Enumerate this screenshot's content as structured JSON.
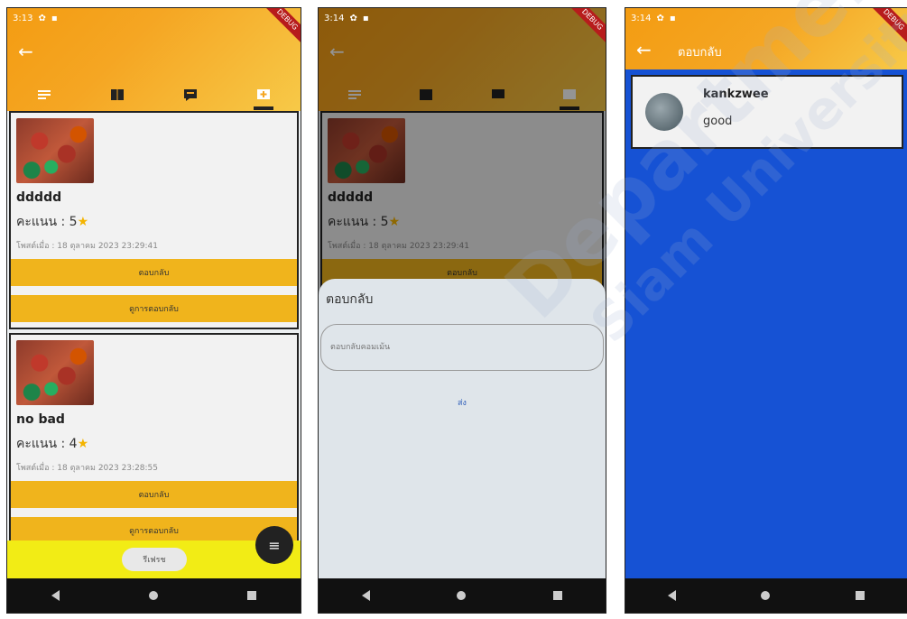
{
  "screens": [
    {
      "status": {
        "time": "3:13"
      },
      "debug_label": "DEBUG",
      "tabs": [
        "list-icon",
        "book-icon",
        "chat-icon",
        "reply-icon"
      ],
      "reviews": [
        {
          "title": "ddddd",
          "rating_label": "คะแนน : 5",
          "star": "★",
          "date": "โพสต์เมื่อ : 18 ตุลาคม 2023 23:29:41",
          "reply_btn": "ตอบกลับ",
          "view_btn": "ดูการตอบกลับ"
        },
        {
          "title": "no bad",
          "rating_label": "คะแนน : 4",
          "star": "★",
          "date": "โพสต์เมื่อ : 18 ตุลาคม 2023 23:28:55",
          "reply_btn": "ตอบกลับ",
          "view_btn": "ดูการตอบกลับ"
        }
      ],
      "pill_label": "รีเฟรช",
      "fab_icon": "menu-icon"
    },
    {
      "status": {
        "time": "3:14"
      },
      "debug_label": "DEBUG",
      "review": {
        "title": "ddddd",
        "rating_label": "คะแนน : 5",
        "star": "★",
        "date": "โพสต์เมื่อ : 18 ตุลาคม 2023 23:29:41",
        "reply_btn": "ตอบกลับ"
      },
      "sheet": {
        "title": "ตอบกลับ",
        "input_placeholder": "ตอบกลับคอมเม้น",
        "send_label": "ส่ง"
      }
    },
    {
      "status": {
        "time": "3:14"
      },
      "debug_label": "DEBUG",
      "title": "ตอบกลับ",
      "reply": {
        "user": "kankzwee",
        "comment": "good"
      }
    }
  ],
  "watermark": {
    "line1": "Department",
    "line2": "Siam University"
  },
  "colors": {
    "accent": "#f0b41c",
    "blue": "#1652d4",
    "yellow": "#f2ec15"
  }
}
